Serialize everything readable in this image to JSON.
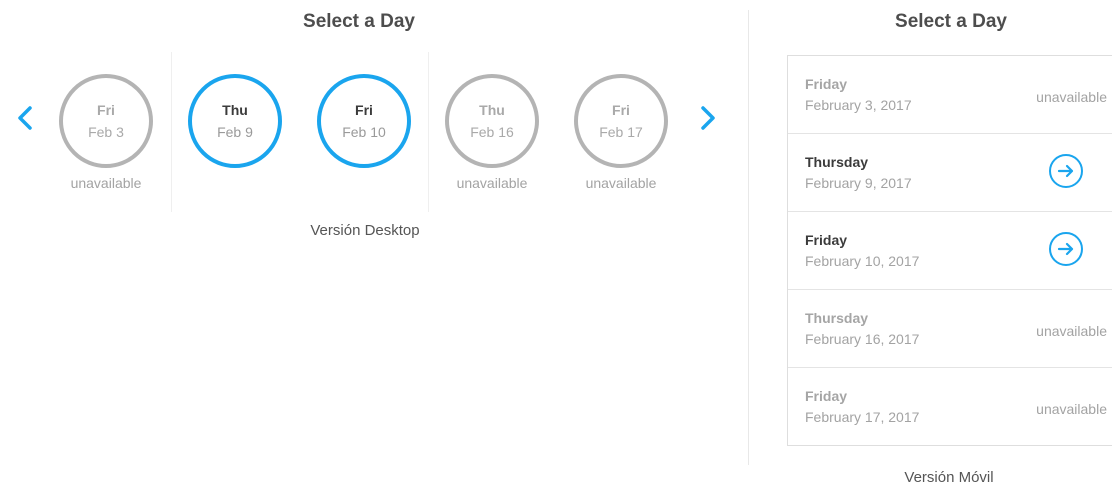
{
  "desktop": {
    "title": "Select a Day",
    "caption": "Versión Desktop",
    "days": [
      {
        "dow": "Fri",
        "date": "Feb 3",
        "status": "unavailable",
        "available": false
      },
      {
        "dow": "Thu",
        "date": "Feb 9",
        "status": "",
        "available": true
      },
      {
        "dow": "Fri",
        "date": "Feb 10",
        "status": "",
        "available": true
      },
      {
        "dow": "Thu",
        "date": "Feb 16",
        "status": "unavailable",
        "available": false
      },
      {
        "dow": "Fri",
        "date": "Feb 17",
        "status": "unavailable",
        "available": false
      }
    ],
    "icons": {
      "prev": "chevron-left-icon",
      "next": "chevron-right-icon"
    }
  },
  "mobile": {
    "title": "Select a Day",
    "caption": "Versión Móvil",
    "rows": [
      {
        "dow": "Friday",
        "date": "February 3, 2017",
        "status": "unavailable",
        "available": false
      },
      {
        "dow": "Thursday",
        "date": "February 9, 2017",
        "status": "",
        "available": true
      },
      {
        "dow": "Friday",
        "date": "February 10, 2017",
        "status": "",
        "available": true
      },
      {
        "dow": "Thursday",
        "date": "February 16, 2017",
        "status": "unavailable",
        "available": false
      },
      {
        "dow": "Friday",
        "date": "February 17, 2017",
        "status": "unavailable",
        "available": false
      }
    ],
    "icons": {
      "go": "arrow-right-circle-icon"
    }
  },
  "colors": {
    "accent": "#1aa5ee",
    "muted": "#b4b4b4",
    "text": "#4d4d4d"
  }
}
